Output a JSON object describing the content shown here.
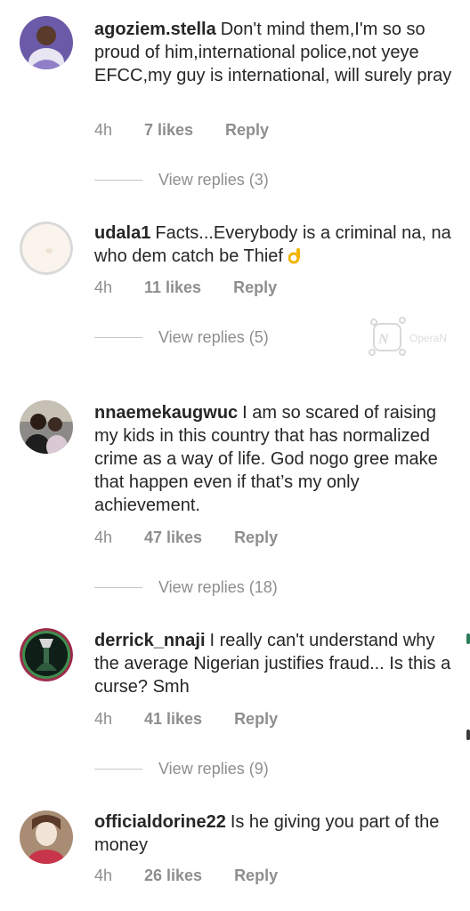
{
  "comments": [
    {
      "username": "agoziem.stella",
      "text": "Don't mind them,I'm so so proud of him,international police,not yeye EFCC,my guy is international, will surely pray",
      "time": "4h",
      "likes": "7 likes",
      "reply": "Reply",
      "view_replies": "View replies (3)"
    },
    {
      "username": "udala1",
      "text": "Facts...Everybody is a criminal na, na who dem catch be Thief",
      "time": "4h",
      "likes": "11 likes",
      "reply": "Reply",
      "view_replies": "View replies (5)"
    },
    {
      "username": "nnaemekaugwuc",
      "text": "I am so scared of raising my kids in this country that has normalized crime as a way of life. God nogo gree make that happen even if that’s my only achievement.",
      "time": "4h",
      "likes": "47 likes",
      "reply": "Reply",
      "view_replies": "View replies (18)"
    },
    {
      "username": "derrick_nnaji",
      "text": "I really can't understand why the average Nigerian justifies fraud... Is this a curse? Smh",
      "time": "4h",
      "likes": "41 likes",
      "reply": "Reply",
      "view_replies": "View replies (9)"
    },
    {
      "username": "officialdorine22",
      "text": "Is he giving you part of the money",
      "time": "4h",
      "likes": "26 likes",
      "reply": "Reply"
    }
  ],
  "icons": {
    "emoji": "ok-hand-emoji-icon",
    "watermark": "operanews-watermark-icon"
  },
  "colors": {
    "text": "#262626",
    "meta": "#8e8e8e",
    "divider": "#c7c7c7"
  }
}
